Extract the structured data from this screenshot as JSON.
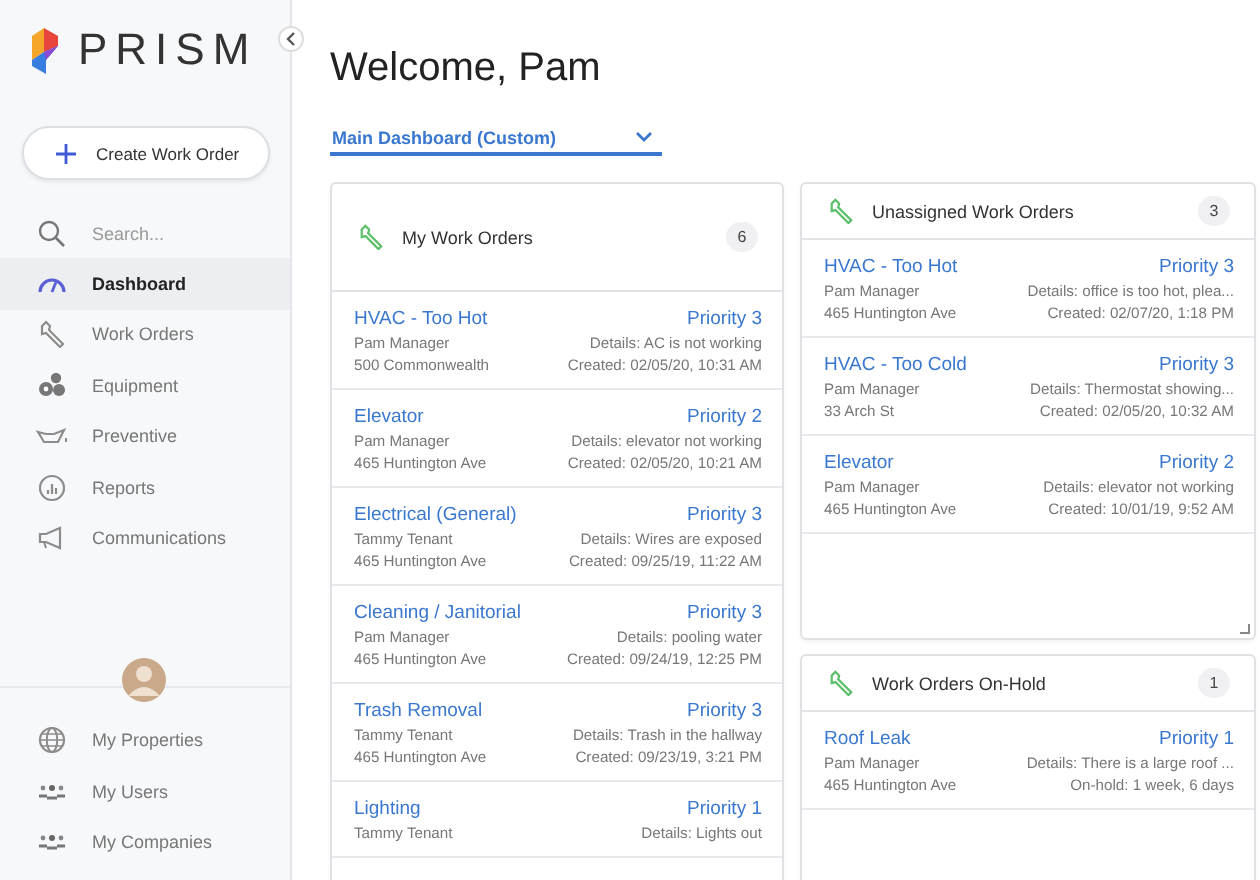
{
  "brand": {
    "name": "PRISM"
  },
  "sidebar": {
    "create_button": "Create Work Order",
    "search": {
      "placeholder": "Search..."
    },
    "items": [
      {
        "label": "Dashboard",
        "selected": true
      },
      {
        "label": "Work Orders",
        "selected": false
      },
      {
        "label": "Equipment",
        "selected": false
      },
      {
        "label": "Preventive",
        "selected": false
      },
      {
        "label": "Reports",
        "selected": false
      },
      {
        "label": "Communications",
        "selected": false
      }
    ],
    "bottom_items": [
      {
        "label": "My Properties",
        "selected": false
      },
      {
        "label": "My Users",
        "selected": false
      },
      {
        "label": "My Companies",
        "selected": false
      }
    ]
  },
  "header": {
    "title": "Welcome, Pam",
    "dashboard_select": "Main Dashboard (Custom)"
  },
  "panels": [
    {
      "title": "My Work Orders",
      "count": "6",
      "rows": [
        {
          "title": "HVAC - Too Hot",
          "priority": "Priority 3",
          "person": "Pam Manager",
          "details": "Details: AC is not working",
          "address": "500 Commonwealth",
          "date_line": "Created: 02/05/20, 10:31 AM"
        },
        {
          "title": "Elevator",
          "priority": "Priority 2",
          "person": "Pam Manager",
          "details": "Details: elevator not working",
          "address": "465 Huntington Ave",
          "date_line": "Created: 02/05/20, 10:21 AM"
        },
        {
          "title": "Electrical (General)",
          "priority": "Priority 3",
          "person": "Tammy Tenant",
          "details": "Details: Wires are exposed",
          "address": "465 Huntington Ave",
          "date_line": "Created: 09/25/19, 11:22 AM"
        },
        {
          "title": "Cleaning / Janitorial",
          "priority": "Priority 3",
          "person": "Pam Manager",
          "details": "Details: pooling water",
          "address": "465 Huntington Ave",
          "date_line": "Created: 09/24/19, 12:25 PM"
        },
        {
          "title": "Trash Removal",
          "priority": "Priority 3",
          "person": "Tammy Tenant",
          "details": "Details: Trash in the hallway",
          "address": "465 Huntington Ave",
          "date_line": "Created: 09/23/19, 3:21 PM"
        },
        {
          "title": "Lighting",
          "priority": "Priority 1",
          "person": "Tammy Tenant",
          "details": "Details: Lights out"
        }
      ]
    },
    {
      "title": "Unassigned Work Orders",
      "count": "3",
      "rows": [
        {
          "title": "HVAC - Too Hot",
          "priority": "Priority 3",
          "person": "Pam Manager",
          "details": "Details: office is too hot, plea...",
          "address": "465 Huntington Ave",
          "date_line": "Created: 02/07/20, 1:18 PM"
        },
        {
          "title": "HVAC - Too Cold",
          "priority": "Priority 3",
          "person": "Pam Manager",
          "details": "Details: Thermostat showing...",
          "address": "33 Arch St",
          "date_line": "Created: 02/05/20, 10:32 AM"
        },
        {
          "title": "Elevator",
          "priority": "Priority 2",
          "person": "Pam Manager",
          "details": "Details: elevator not working",
          "address": "465 Huntington Ave",
          "date_line": "Created: 10/01/19, 9:52 AM"
        }
      ]
    },
    {
      "title": "Work Orders On-Hold",
      "count": "1",
      "rows": [
        {
          "title": "Roof Leak",
          "priority": "Priority 1",
          "person": "Pam Manager",
          "details": "Details: There is a large roof ...",
          "address": "465 Huntington Ave",
          "date_line": "On-hold: 1 week, 6 days"
        }
      ]
    }
  ]
}
